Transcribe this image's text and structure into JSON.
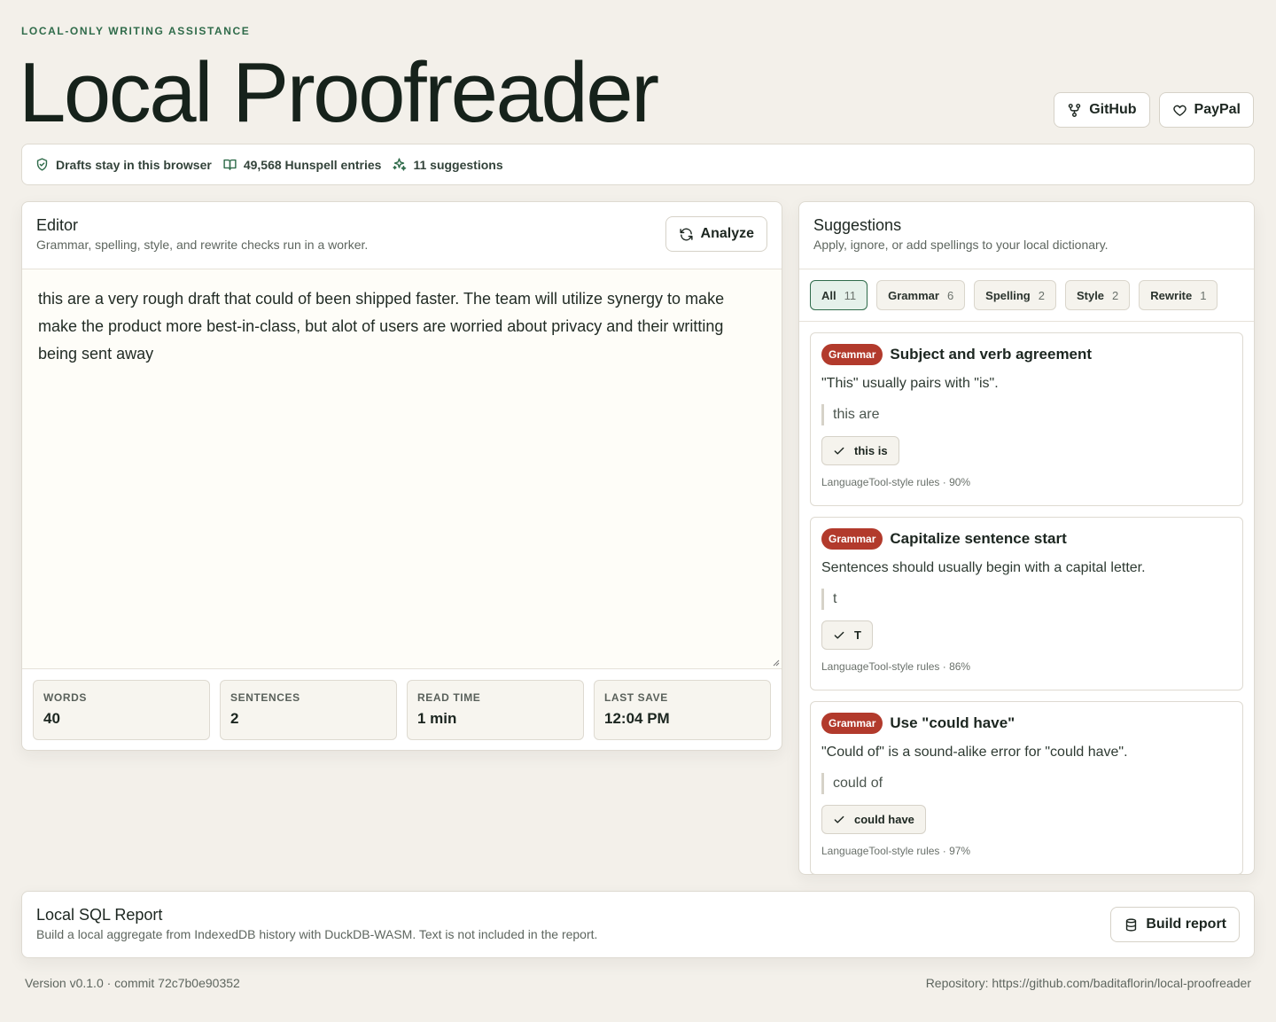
{
  "header": {
    "eyebrow": "LOCAL-ONLY WRITING ASSISTANCE",
    "title": "Local Proofreader",
    "github_label": "GitHub",
    "paypal_label": "PayPal"
  },
  "status": {
    "privacy": "Drafts stay in this browser",
    "dictionary": "49,568 Hunspell entries",
    "suggestions": "11 suggestions"
  },
  "editor": {
    "title": "Editor",
    "subtitle": "Grammar, spelling, style, and rewrite checks run in a worker.",
    "analyze_label": "Analyze",
    "text": "this are a very rough draft that could of been shipped faster. The team will utilize synergy to make make the product more best-in-class, but alot of users are worried about privacy and their writting being sent away",
    "stats": [
      {
        "label": "WORDS",
        "value": "40"
      },
      {
        "label": "SENTENCES",
        "value": "2"
      },
      {
        "label": "READ TIME",
        "value": "1 min"
      },
      {
        "label": "LAST SAVE",
        "value": "12:04 PM"
      }
    ]
  },
  "suggestions": {
    "title": "Suggestions",
    "subtitle": "Apply, ignore, or add spellings to your local dictionary.",
    "filters": [
      {
        "label": "All",
        "count": "11",
        "active": true
      },
      {
        "label": "Grammar",
        "count": "6",
        "active": false
      },
      {
        "label": "Spelling",
        "count": "2",
        "active": false
      },
      {
        "label": "Style",
        "count": "2",
        "active": false
      },
      {
        "label": "Rewrite",
        "count": "1",
        "active": false
      }
    ],
    "cards": [
      {
        "badge": "Grammar",
        "title": "Subject and verb agreement",
        "message": "\"This\" usually pairs with \"is\".",
        "quote": "this are",
        "fix": "this is",
        "meta": "LanguageTool-style rules · 90%"
      },
      {
        "badge": "Grammar",
        "title": "Capitalize sentence start",
        "message": "Sentences should usually begin with a capital letter.",
        "quote": "t",
        "fix": "T",
        "meta": "LanguageTool-style rules · 86%"
      },
      {
        "badge": "Grammar",
        "title": "Use \"could have\"",
        "message": "\"Could of\" is a sound-alike error for \"could have\".",
        "quote": "could of",
        "fix": "could have",
        "meta": "LanguageTool-style rules · 97%"
      }
    ]
  },
  "report": {
    "title": "Local SQL Report",
    "subtitle": "Build a local aggregate from IndexedDB history with DuckDB-WASM. Text is not included in the report.",
    "button_label": "Build report"
  },
  "footer": {
    "version": "Version v0.1.0 · commit 72c7b0e90352",
    "repository": "Repository: https://github.com/baditaflorin/local-proofreader"
  },
  "colors": {
    "accent": "#2f6b4a",
    "badge": "#b23a2c",
    "background": "#f3f0ea"
  }
}
